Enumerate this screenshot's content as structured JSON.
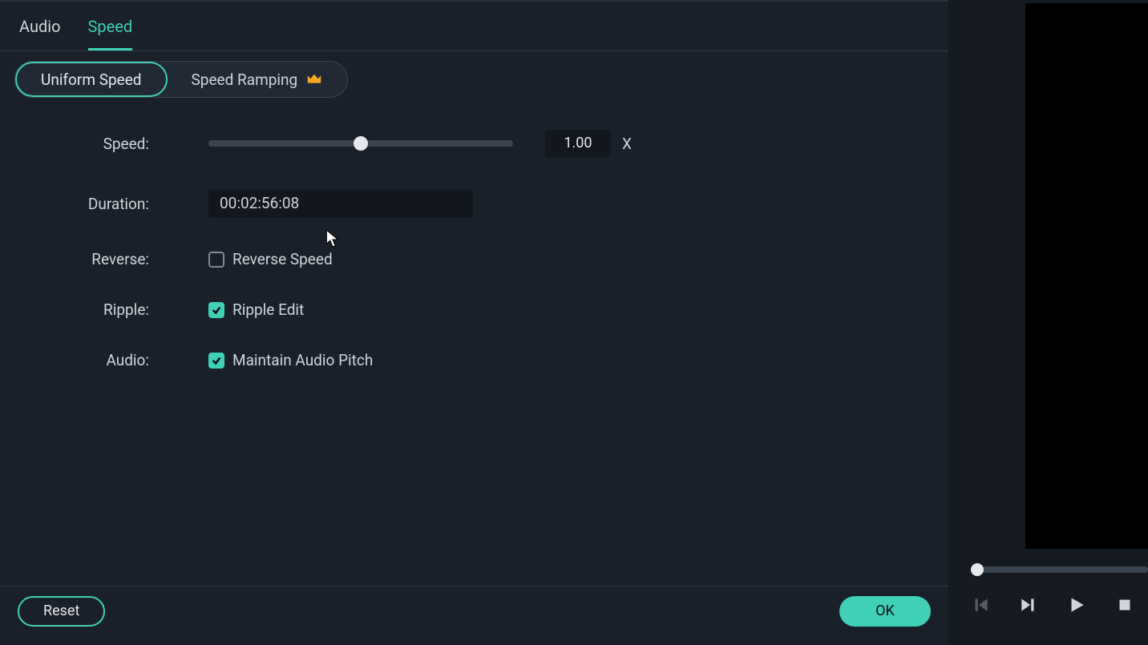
{
  "tabs": {
    "audio": "Audio",
    "speed": "Speed",
    "active": "speed"
  },
  "modes": {
    "uniform": "Uniform Speed",
    "ramping": "Speed Ramping",
    "selected": "uniform"
  },
  "icons": {
    "crown": "crown-icon"
  },
  "speed": {
    "label": "Speed:",
    "value": "1.00",
    "unit": "X",
    "slider_percent": 50
  },
  "duration": {
    "label": "Duration:",
    "value": "00:02:56:08"
  },
  "reverse": {
    "label": "Reverse:",
    "option": "Reverse Speed",
    "checked": false
  },
  "ripple": {
    "label": "Ripple:",
    "option": "Ripple Edit",
    "checked": true
  },
  "audio_opt": {
    "label": "Audio:",
    "option": "Maintain Audio Pitch",
    "checked": true
  },
  "buttons": {
    "reset": "Reset",
    "ok": "OK"
  },
  "colors": {
    "accent": "#3fd0b6",
    "bg": "#1a2029",
    "text": "#cfd5db"
  },
  "preview": {
    "scrub_percent": 2
  }
}
